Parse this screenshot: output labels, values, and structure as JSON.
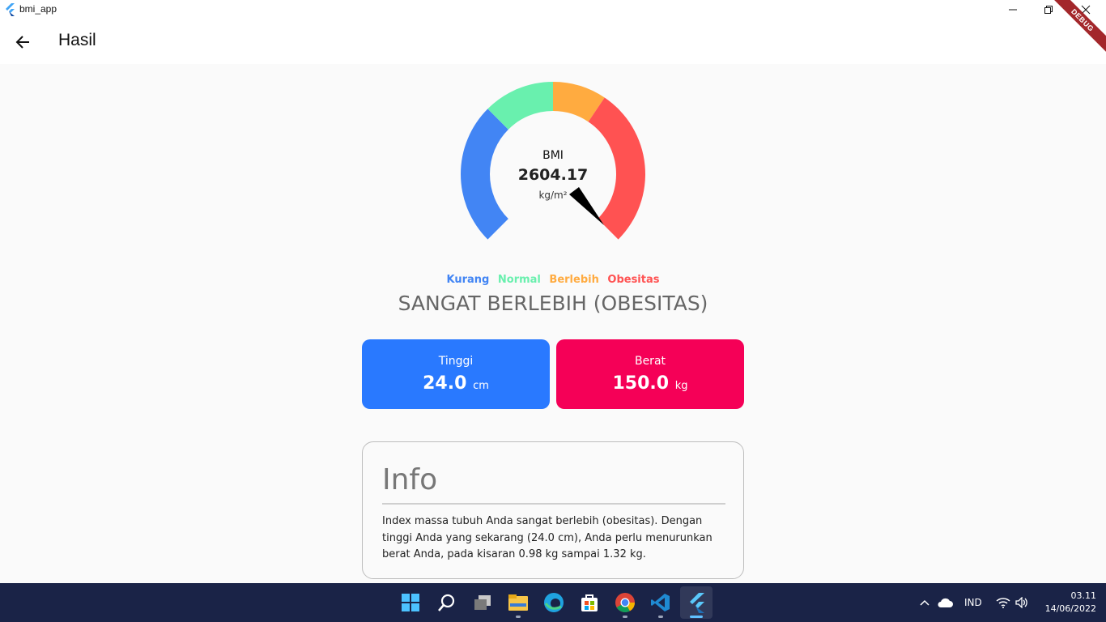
{
  "window": {
    "title": "bmi_app"
  },
  "appbar": {
    "title": "Hasil",
    "debug_banner": "DEBUG"
  },
  "gauge": {
    "label": "BMI",
    "value": "2604.17",
    "unit": "kg/m²",
    "colors": {
      "kurang": "#4285f4",
      "normal": "#69f0ae",
      "berlebih": "#ffab40",
      "obesitas": "#ff5252"
    }
  },
  "legend": {
    "items": [
      {
        "label": "Kurang",
        "color": "#4285f4"
      },
      {
        "label": "Normal",
        "color": "#69f0ae"
      },
      {
        "label": "Berlebih",
        "color": "#ffab40"
      },
      {
        "label": "Obesitas",
        "color": "#ff5252"
      }
    ]
  },
  "status": "SANGAT BERLEBIH (OBESITAS)",
  "cards": {
    "tinggi": {
      "label": "Tinggi",
      "value": "24.0",
      "unit": "cm",
      "color": "#2979ff"
    },
    "berat": {
      "label": "Berat",
      "value": "150.0",
      "unit": "kg",
      "color": "#f50057"
    }
  },
  "info": {
    "title": "Info",
    "body": "Index massa tubuh Anda sangat berlebih (obesitas). Dengan tinggi Anda yang sekarang (24.0 cm), Anda perlu menurunkan berat Anda, pada kisaran 0.98 kg sampai 1.32 kg."
  },
  "taskbar": {
    "icons": [
      "windows-start-icon",
      "search-icon",
      "task-view-icon",
      "file-explorer-icon",
      "edge-icon",
      "store-icon",
      "chrome-icon",
      "vscode-icon",
      "flutter-icon"
    ],
    "language": "IND",
    "time": "03.11",
    "date": "14/06/2022"
  }
}
